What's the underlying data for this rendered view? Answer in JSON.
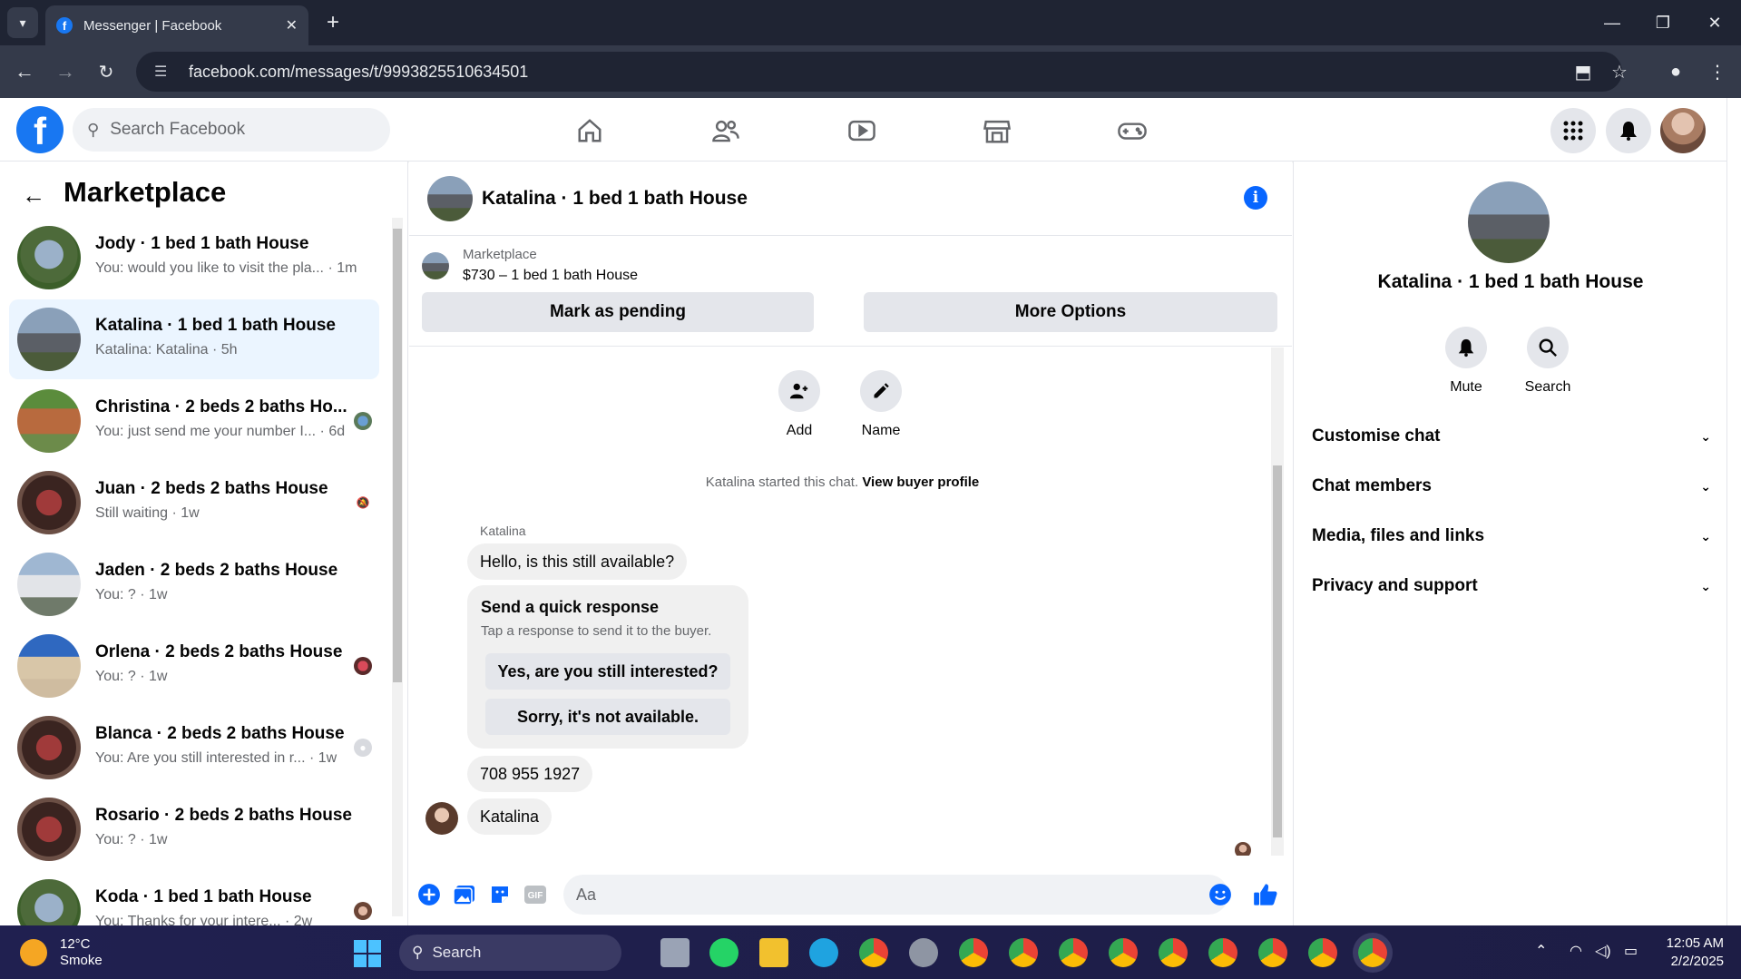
{
  "browser": {
    "tab_title": "Messenger | Facebook",
    "url": "facebook.com/messages/t/9993825510634501"
  },
  "fb": {
    "logo": "f",
    "search_placeholder": "Search Facebook",
    "nav_icons": [
      "home-icon",
      "friends-icon",
      "video-icon",
      "marketplace-icon",
      "gaming-icon"
    ],
    "accent": "#0866ff"
  },
  "sidebar": {
    "title": "Marketplace",
    "conversations": [
      {
        "name": "Jody · 1 bed 1 bath House",
        "snippet": "You: would you like to visit the pla... · 1m"
      },
      {
        "name": "Katalina · 1 bed 1 bath House",
        "snippet": "Katalina: Katalina · 5h"
      },
      {
        "name": "Christina · 2 beds 2 baths Ho...",
        "snippet": "You: just send me your number I... · 6d"
      },
      {
        "name": "Juan · 2 beds 2 baths House",
        "snippet": "Still waiting · 1w"
      },
      {
        "name": "Jaden · 2 beds 2 baths House",
        "snippet": "You: ? · 1w"
      },
      {
        "name": "Orlena · 2 beds 2 baths House",
        "snippet": "You: ? · 1w"
      },
      {
        "name": "Blanca · 2 beds 2 baths House",
        "snippet": "You: Are you still interested in r... · 1w"
      },
      {
        "name": "Rosario · 2 beds 2 baths House",
        "snippet": "You: ? · 1w"
      },
      {
        "name": "Koda · 1 bed 1 bath House",
        "snippet": "You: Thanks for your intere... · 2w"
      }
    ]
  },
  "chat": {
    "title": "Katalina · 1 bed 1 bath House",
    "listing_source": "Marketplace",
    "listing_price": "$730 – 1 bed 1 bath House",
    "mark_pending": "Mark as pending",
    "more_options": "More Options",
    "add_label": "Add",
    "name_label": "Name",
    "started_text": "Katalina started this chat.",
    "view_profile": "View buyer profile",
    "sender": "Katalina",
    "msg1": "Hello, is this still available?",
    "quick_title": "Send a quick response",
    "quick_sub": "Tap a response to send it to the buyer.",
    "quick1": "Yes, are you still interested?",
    "quick2": "Sorry, it's not available.",
    "msg2": "708 955 1927",
    "msg3": "Katalina",
    "input_placeholder": "Aa"
  },
  "details": {
    "name": "Katalina · 1 bed 1 bath House",
    "mute": "Mute",
    "search": "Search",
    "sections": [
      "Customise chat",
      "Chat members",
      "Media, files and links",
      "Privacy and support"
    ]
  },
  "taskbar": {
    "temp": "12°C",
    "weather": "Smoke",
    "search": "Search",
    "time": "12:05 AM",
    "date": "2/2/2025"
  }
}
